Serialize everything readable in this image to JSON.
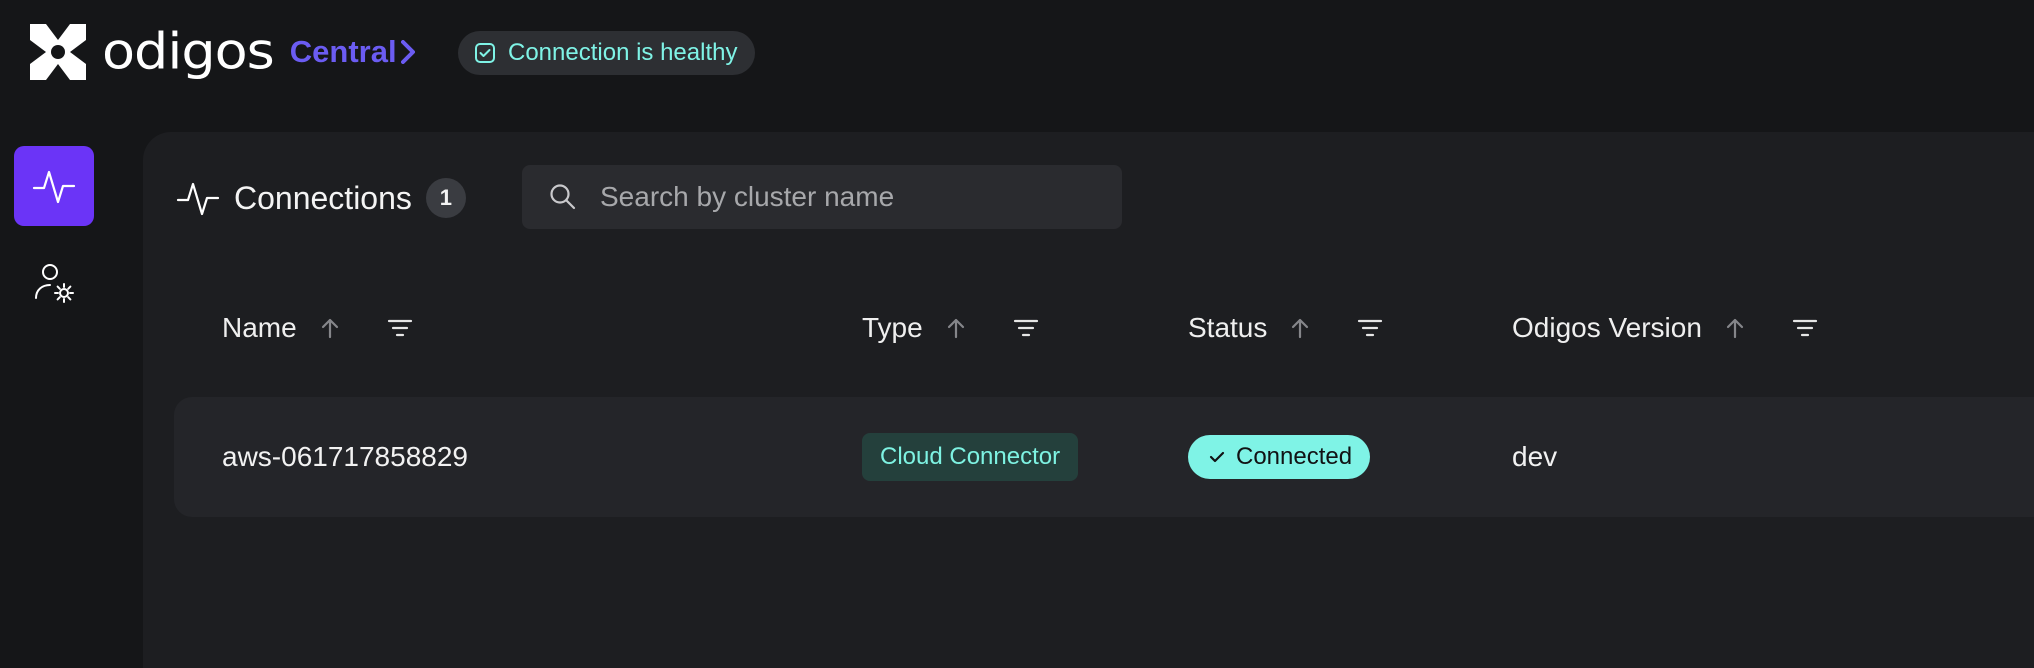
{
  "header": {
    "logo_text": "odigos",
    "product": "Central",
    "health_status": "Connection is healthy"
  },
  "sidebar": {
    "items": [
      {
        "icon": "pulse-icon",
        "active": true
      },
      {
        "icon": "user-settings-icon",
        "active": false
      }
    ]
  },
  "connections": {
    "title": "Connections",
    "count": "1"
  },
  "search": {
    "placeholder": "Search by cluster name"
  },
  "table": {
    "columns": [
      {
        "label": "Name"
      },
      {
        "label": "Type"
      },
      {
        "label": "Status"
      },
      {
        "label": "Odigos Version"
      }
    ],
    "rows": [
      {
        "name": "aws-061717858829",
        "type": "Cloud Connector",
        "status": "Connected",
        "version": "dev"
      }
    ]
  },
  "colors": {
    "accent": "#6b34f7",
    "brand_text": "#6b5cf2",
    "healthy": "#7ff3e6"
  }
}
